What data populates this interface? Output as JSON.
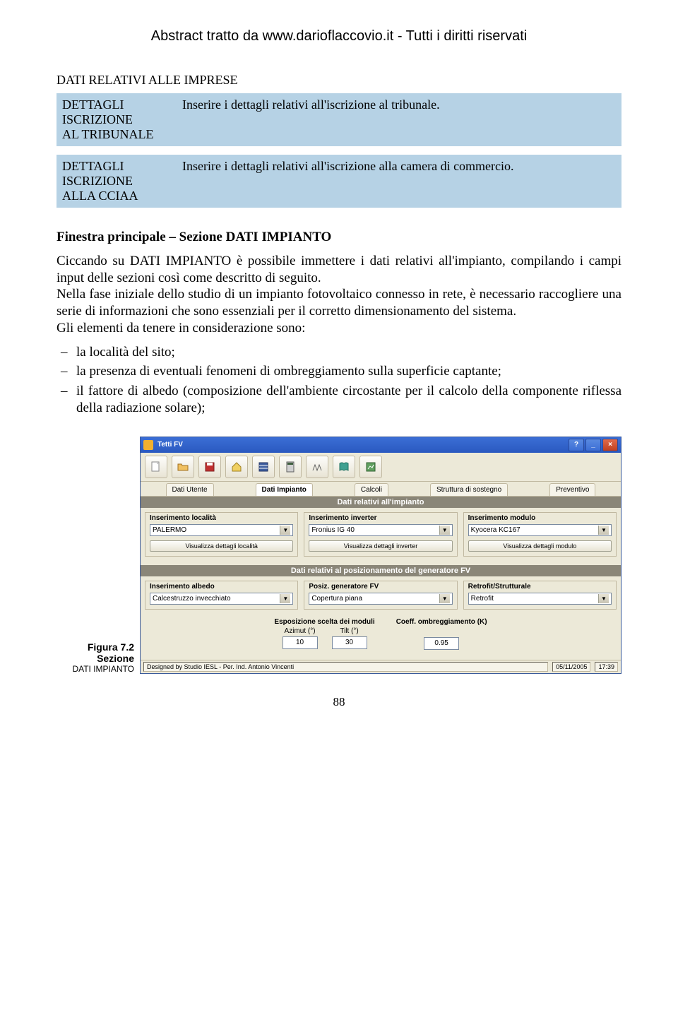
{
  "header": "Abstract tratto da www.darioflaccovio.it - Tutti i diritti riservati",
  "section_heading": "DATI RELATIVI ALLE IMPRESE",
  "box1": {
    "left1": "DETTAGLI",
    "left2": "ISCRIZIONE",
    "left3": "AL TRIBUNALE",
    "right": "Inserire i dettagli relativi all'iscrizione al tribunale."
  },
  "box2": {
    "left1": "DETTAGLI",
    "left2": "ISCRIZIONE",
    "left3": "ALLA CCIAA",
    "right": "Inserire i dettagli relativi all'iscrizione alla camera di commercio."
  },
  "main": {
    "heading_plain": "Finestra principale – Sezione ",
    "heading_sc": "DATI IMPIANTO",
    "p1a": "Ciccando su ",
    "p1sc": "DATI IMPIANTO",
    "p1b": " è possibile immettere i dati relativi all'impianto, compilando i campi input delle sezioni così come descritto di seguito.",
    "p2": "Nella fase iniziale dello studio di un impianto fotovoltaico connesso in rete, è necessario raccogliere una serie di informazioni che sono essenziali per il corretto dimensionamento del sistema.",
    "p3": "Gli elementi da tenere in considerazione sono:",
    "li1": "la località del sito;",
    "li2": "la presenza di eventuali fenomeni di ombreggiamento sulla superficie captante;",
    "li3": "il fattore di albedo (composizione dell'ambiente circostante per il calcolo della componente riflessa della radiazione solare);"
  },
  "app": {
    "title": "Tetti FV",
    "tabs": {
      "t1": "Dati Utente",
      "t2": "Dati Impianto",
      "t3": "Calcoli",
      "t4": "Struttura di sostegno",
      "t5": "Preventivo"
    },
    "bar1": "Dati relativi all'impianto",
    "g_localita": {
      "title": "Inserimento località",
      "value": "PALERMO",
      "btn": "Visualizza dettagli località"
    },
    "g_inverter": {
      "title": "Inserimento inverter",
      "value": "Fronius IG 40",
      "btn": "Visualizza dettagli inverter"
    },
    "g_modulo": {
      "title": "Inserimento modulo",
      "value": "Kyocera    KC167",
      "btn": "Visualizza dettagli modulo"
    },
    "bar2": "Dati relativi al posizionamento del generatore FV",
    "g_albedo": {
      "title": "Inserimento albedo",
      "value": "Calcestruzzo invecchiato"
    },
    "g_posiz": {
      "title": "Posiz. generatore FV",
      "value": "Copertura piana"
    },
    "g_retrofit": {
      "title": "Retrofit/Strutturale",
      "value": "Retrofit"
    },
    "expo_title": "Esposizione scelta dei moduli",
    "azimut_lbl": "Azimut (°)",
    "azimut_val": "10",
    "tilt_lbl": "Tilt (°)",
    "tilt_val": "30",
    "coeff_title": "Coeff. ombreggiamento (K)",
    "coeff_val": "0.95",
    "status_design": "Designed by Studio IESL - Per. Ind. Antonio Vincenti",
    "status_date": "05/11/2005",
    "status_time": "17:39"
  },
  "figure": {
    "num": "Figura 7.2",
    "line2": "Sezione",
    "line3": "DATI IMPIANTO"
  },
  "page_number": "88"
}
